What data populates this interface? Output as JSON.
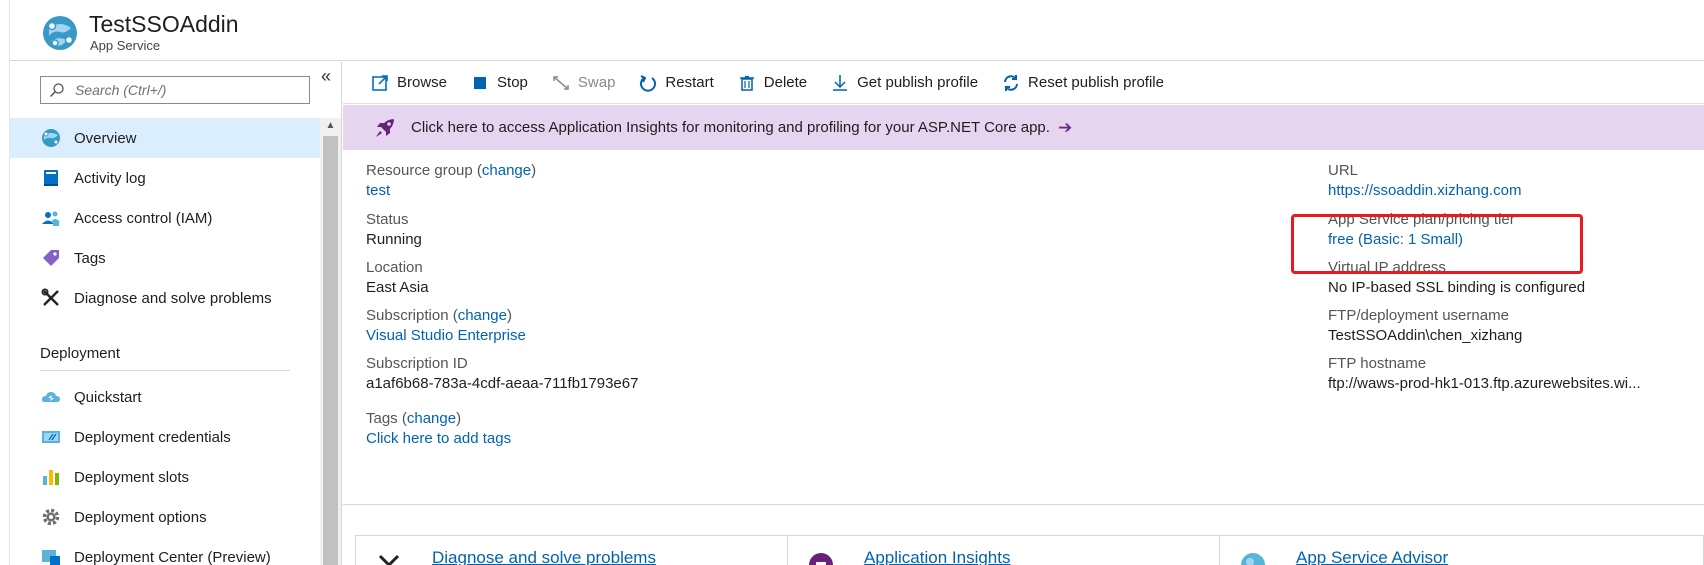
{
  "header": {
    "title": "TestSSOAddin",
    "subtitle": "App Service"
  },
  "sidebar": {
    "search_placeholder": "Search (Ctrl+/)",
    "collapse_symbol": "«",
    "items": [
      {
        "label": "Overview",
        "icon": "app-service-globe-icon",
        "active": true
      },
      {
        "label": "Activity log",
        "icon": "activity-log-icon"
      },
      {
        "label": "Access control (IAM)",
        "icon": "users-icon"
      },
      {
        "label": "Tags",
        "icon": "tag-icon"
      },
      {
        "label": "Diagnose and solve problems",
        "icon": "wrench-icon"
      }
    ],
    "section_title": "Deployment",
    "deployment_items": [
      {
        "label": "Quickstart",
        "icon": "cloud-icon"
      },
      {
        "label": "Deployment credentials",
        "icon": "credentials-icon"
      },
      {
        "label": "Deployment slots",
        "icon": "slots-icon"
      },
      {
        "label": "Deployment options",
        "icon": "gear-icon"
      },
      {
        "label": "Deployment Center (Preview)",
        "icon": "deployment-center-icon"
      }
    ]
  },
  "toolbar": {
    "browse": "Browse",
    "stop": "Stop",
    "swap": "Swap",
    "restart": "Restart",
    "delete": "Delete",
    "get_publish_profile": "Get publish profile",
    "reset_publish_profile": "Reset publish profile"
  },
  "banner": {
    "text": "Click here to access Application Insights for monitoring and profiling for your ASP.NET Core app.",
    "arrow": "➔"
  },
  "essentials": {
    "resource_group_label": "Resource group",
    "resource_group_value": "test",
    "status_label": "Status",
    "status_value": "Running",
    "location_label": "Location",
    "location_value": "East Asia",
    "subscription_label": "Subscription",
    "subscription_value": "Visual Studio Enterprise",
    "subscription_id_label": "Subscription ID",
    "subscription_id_value": "a1af6b68-783a-4cdf-aeaa-711fb1793e67",
    "tags_label": "Tags",
    "tags_value": "Click here to add tags",
    "change_text": "change",
    "url_label": "URL",
    "url_value": "https://ssoaddin.xizhang.com",
    "plan_label": "App Service plan/pricing tier",
    "plan_value": "free (Basic: 1 Small)",
    "vip_label": "Virtual IP address",
    "vip_value": "No IP-based SSL binding is configured",
    "ftp_user_label": "FTP/deployment username",
    "ftp_user_value": "TestSSOAddin\\chen_xizhang",
    "ftp_host_label": "FTP hostname",
    "ftp_host_value": "ftp://waws-prod-hk1-013.ftp.azurewebsites.wi..."
  },
  "cards": [
    {
      "title": "Diagnose and solve problems",
      "icon": "wrench-icon"
    },
    {
      "title": "Application Insights",
      "icon": "app-insights-icon"
    },
    {
      "title": "App Service Advisor",
      "icon": "advisor-icon"
    }
  ],
  "colors": {
    "link": "#0063b1",
    "banner_bg": "#e6d5ef",
    "active_nav": "#dbeefd",
    "highlight": "#e8191f"
  }
}
